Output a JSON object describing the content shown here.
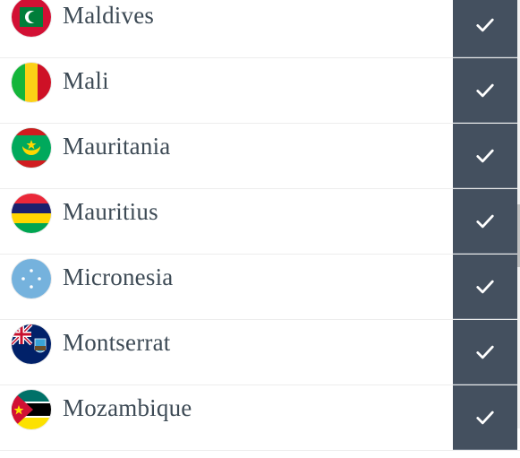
{
  "countries": [
    {
      "name": "Maldives",
      "flag_icon": "maldives-flag-icon",
      "selected": true
    },
    {
      "name": "Mali",
      "flag_icon": "mali-flag-icon",
      "selected": true
    },
    {
      "name": "Mauritania",
      "flag_icon": "mauritania-flag-icon",
      "selected": true
    },
    {
      "name": "Mauritius",
      "flag_icon": "mauritius-flag-icon",
      "selected": true
    },
    {
      "name": "Micronesia",
      "flag_icon": "micronesia-flag-icon",
      "selected": true
    },
    {
      "name": "Montserrat",
      "flag_icon": "montserrat-flag-icon",
      "selected": true
    },
    {
      "name": "Mozambique",
      "flag_icon": "mozambique-flag-icon",
      "selected": true
    }
  ],
  "colors": {
    "check_bg": "#44505f",
    "text": "#3d4a55",
    "divider": "#ececec"
  }
}
